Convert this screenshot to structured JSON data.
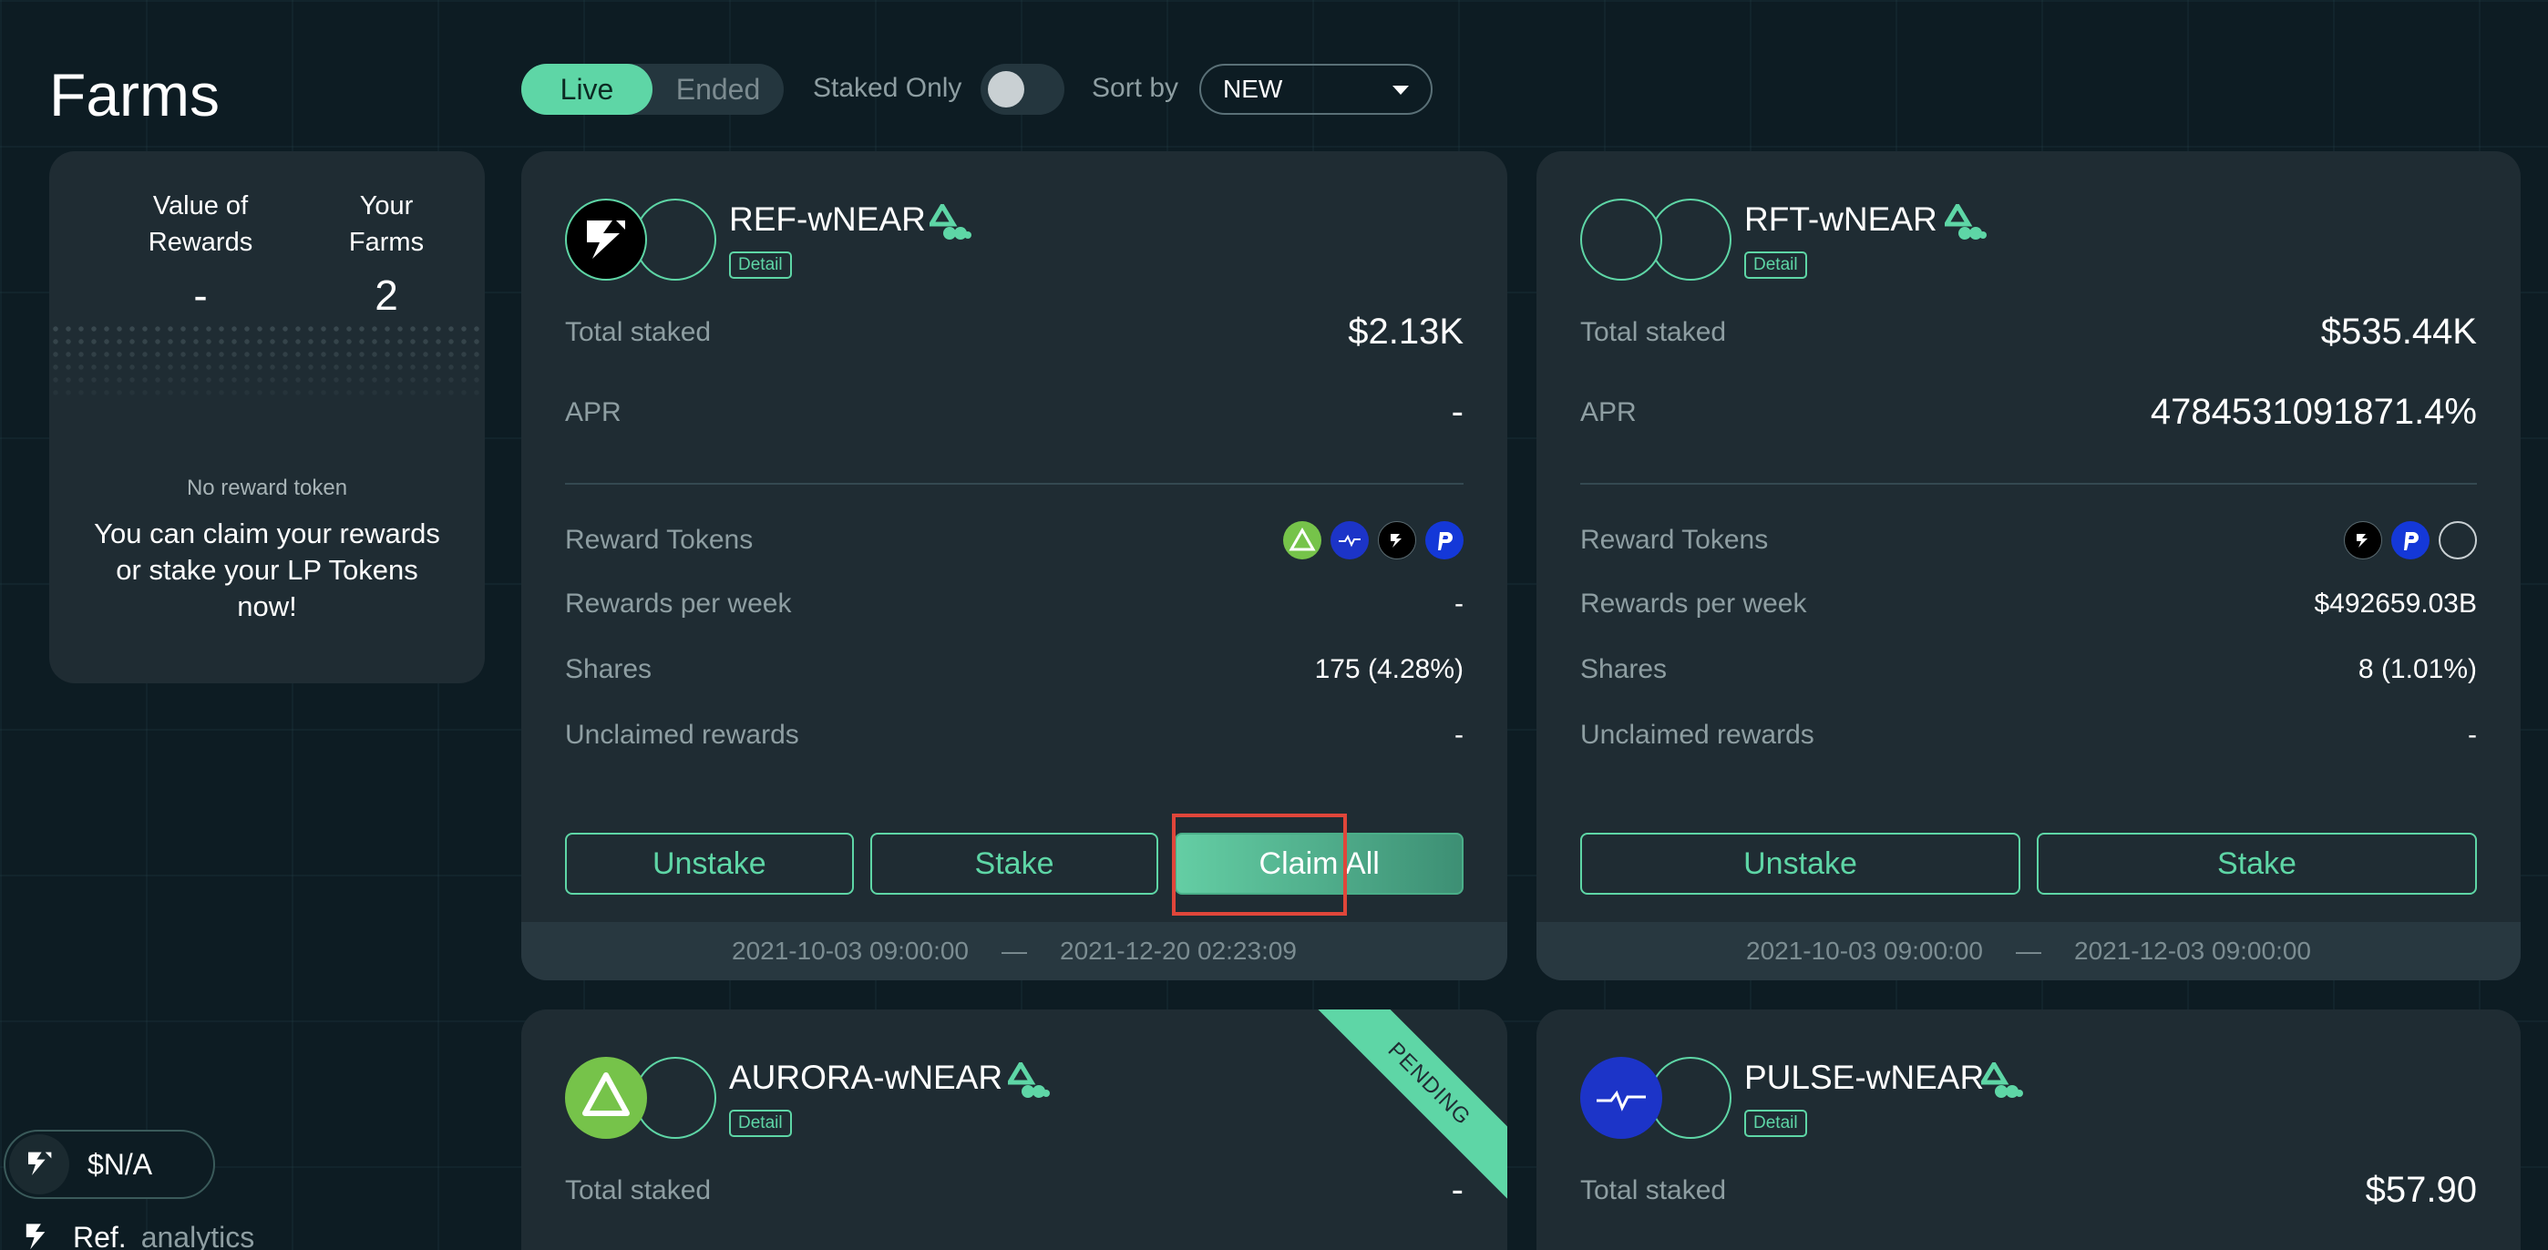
{
  "page": {
    "title": "Farms"
  },
  "filters": {
    "live_label": "Live",
    "ended_label": "Ended",
    "staked_only_label": "Staked Only",
    "sort_label": "Sort by",
    "sort_value": "NEW"
  },
  "summary": {
    "value_label": "Value of Rewards",
    "value": "-",
    "farms_label": "Your Farms",
    "farms": "2",
    "no_reward": "No reward token",
    "note": "You can claim your rewards or stake your LP Tokens now!"
  },
  "labels": {
    "total_staked": "Total staked",
    "apr": "APR",
    "reward_tokens": "Reward Tokens",
    "rewards_per_week": "Rewards per week",
    "shares": "Shares",
    "unclaimed": "Unclaimed rewards",
    "detail": "Detail",
    "unstake": "Unstake",
    "stake": "Stake",
    "claim_all": "Claim All",
    "date_sep": "—"
  },
  "farms": [
    {
      "name": "REF-wNEAR",
      "total_staked": "$2.13K",
      "apr": "-",
      "reward_tokens": [
        "aurora-token",
        "pulse-token",
        "ref-token",
        "paras-token"
      ],
      "rewards_per_week": "-",
      "shares": "175 (4.28%)",
      "unclaimed": "-",
      "start": "2021-10-03 09:00:00",
      "end": "2021-12-20 02:23:09"
    },
    {
      "name": "RFT-wNEAR",
      "total_staked": "$535.44K",
      "apr": "4784531091871.4%",
      "reward_tokens": [
        "ref-token",
        "paras-token",
        "blank-token"
      ],
      "rewards_per_week": "$492659.03B",
      "shares": "8 (1.01%)",
      "unclaimed": "-",
      "start": "2021-10-03 09:00:00",
      "end": "2021-12-03 09:00:00"
    },
    {
      "name": "AURORA-wNEAR",
      "badge": "PENDING",
      "total_staked": "-"
    },
    {
      "name": "PULSE-wNEAR",
      "total_staked": "$57.90"
    }
  ],
  "footer": {
    "price": "$N/A",
    "brand_main": "Ref.",
    "brand_sub": "analytics"
  },
  "colors": {
    "accent": "#5ed6a6",
    "background": "#0d1c23",
    "card": "#1f2c33",
    "highlight": "#e0463a"
  }
}
